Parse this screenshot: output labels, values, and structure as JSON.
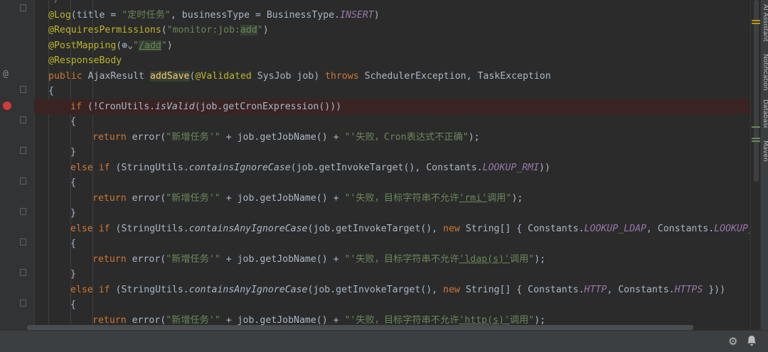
{
  "editor": {
    "lines": [
      {
        "indent": 0,
        "parts": [
          {
            "t": "@Log",
            "c": "c-ann"
          },
          {
            "t": "(title = "
          },
          {
            "t": "\"定时任务\"",
            "c": "c-str"
          },
          {
            "t": ", businessType = BusinessType."
          },
          {
            "t": "INSERT",
            "c": "c-const"
          },
          {
            "t": ")"
          }
        ]
      },
      {
        "indent": 0,
        "parts": [
          {
            "t": "@RequiresPermissions",
            "c": "c-ann"
          },
          {
            "t": "("
          },
          {
            "t": "\"monitor:job:",
            "c": "c-str"
          },
          {
            "t": "add",
            "c": "c-str c-hl"
          },
          {
            "t": "\"",
            "c": "c-str"
          },
          {
            "t": ")"
          }
        ]
      },
      {
        "indent": 0,
        "parts": [
          {
            "t": "@PostMapping",
            "c": "c-ann"
          },
          {
            "t": "(⊕⌄"
          },
          {
            "t": "\"",
            "c": "c-str"
          },
          {
            "t": "/add",
            "c": "c-str c-hl c-under"
          },
          {
            "t": "\"",
            "c": "c-str"
          },
          {
            "t": ")"
          }
        ]
      },
      {
        "indent": 0,
        "parts": [
          {
            "t": "@ResponseBody",
            "c": "c-ann"
          }
        ]
      },
      {
        "indent": 0,
        "parts": [
          {
            "t": "public ",
            "c": "c-kw"
          },
          {
            "t": "AjaxResult "
          },
          {
            "t": "addSave",
            "c": "c-fn c-hl"
          },
          {
            "t": "("
          },
          {
            "t": "@Validated",
            "c": "c-ann"
          },
          {
            "t": " SysJob job) "
          },
          {
            "t": "throws ",
            "c": "c-kw"
          },
          {
            "t": "SchedulerException, TaskException"
          }
        ]
      },
      {
        "indent": 0,
        "parts": [
          {
            "t": "{"
          }
        ]
      },
      {
        "indent": 1,
        "bp": true,
        "parts": [
          {
            "t": "if ",
            "c": "c-kw"
          },
          {
            "t": "(!CronUtils."
          },
          {
            "t": "isValid",
            "c": "c-ital"
          },
          {
            "t": "(job.getCronExpression()))"
          }
        ]
      },
      {
        "indent": 1,
        "parts": [
          {
            "t": "{"
          }
        ]
      },
      {
        "indent": 2,
        "parts": [
          {
            "t": "return ",
            "c": "c-kw"
          },
          {
            "t": "error("
          },
          {
            "t": "\"新增任务'\"",
            "c": "c-str"
          },
          {
            "t": " + job.getJobName() + "
          },
          {
            "t": "\"'失败，Cron表达式不正确\"",
            "c": "c-str"
          },
          {
            "t": ");"
          }
        ]
      },
      {
        "indent": 1,
        "parts": [
          {
            "t": "}"
          }
        ]
      },
      {
        "indent": 1,
        "parts": [
          {
            "t": "else if ",
            "c": "c-kw"
          },
          {
            "t": "(StringUtils."
          },
          {
            "t": "containsIgnoreCase",
            "c": "c-ital"
          },
          {
            "t": "(job.getInvokeTarget(), Constants."
          },
          {
            "t": "LOOKUP_RMI",
            "c": "c-const"
          },
          {
            "t": "))"
          }
        ]
      },
      {
        "indent": 1,
        "parts": [
          {
            "t": "{"
          }
        ]
      },
      {
        "indent": 2,
        "parts": [
          {
            "t": "return ",
            "c": "c-kw"
          },
          {
            "t": "error("
          },
          {
            "t": "\"新增任务'\"",
            "c": "c-str"
          },
          {
            "t": " + job.getJobName() + "
          },
          {
            "t": "\"'失败，目标字符串不允许",
            "c": "c-str"
          },
          {
            "t": "'rmi'",
            "c": "c-str c-under"
          },
          {
            "t": "调用\"",
            "c": "c-str"
          },
          {
            "t": ");"
          }
        ]
      },
      {
        "indent": 1,
        "parts": [
          {
            "t": "}"
          }
        ]
      },
      {
        "indent": 1,
        "parts": [
          {
            "t": "else if ",
            "c": "c-kw"
          },
          {
            "t": "(StringUtils."
          },
          {
            "t": "containsAnyIgnoreCase",
            "c": "c-ital"
          },
          {
            "t": "(job.getInvokeTarget(), "
          },
          {
            "t": "new ",
            "c": "c-kw"
          },
          {
            "t": "String[] { Constants."
          },
          {
            "t": "LOOKUP_LDAP",
            "c": "c-const"
          },
          {
            "t": ", Constants."
          },
          {
            "t": "LOOKUP_LDAP",
            "c": "c-const"
          }
        ]
      },
      {
        "indent": 1,
        "parts": [
          {
            "t": "{"
          }
        ]
      },
      {
        "indent": 2,
        "parts": [
          {
            "t": "return ",
            "c": "c-kw"
          },
          {
            "t": "error("
          },
          {
            "t": "\"新增任务'\"",
            "c": "c-str"
          },
          {
            "t": " + job.getJobName() + "
          },
          {
            "t": "\"'失败，目标字符串不允许",
            "c": "c-str"
          },
          {
            "t": "'ldap(s)'",
            "c": "c-str c-under"
          },
          {
            "t": "调用\"",
            "c": "c-str"
          },
          {
            "t": ");"
          }
        ]
      },
      {
        "indent": 1,
        "parts": [
          {
            "t": "}"
          }
        ]
      },
      {
        "indent": 1,
        "parts": [
          {
            "t": "else if ",
            "c": "c-kw"
          },
          {
            "t": "(StringUtils."
          },
          {
            "t": "containsAnyIgnoreCase",
            "c": "c-ital"
          },
          {
            "t": "(job.getInvokeTarget(), "
          },
          {
            "t": "new ",
            "c": "c-kw"
          },
          {
            "t": "String[] { Constants."
          },
          {
            "t": "HTTP",
            "c": "c-const"
          },
          {
            "t": ", Constants."
          },
          {
            "t": "HTTPS",
            "c": "c-const"
          },
          {
            "t": " }))"
          }
        ]
      },
      {
        "indent": 1,
        "parts": [
          {
            "t": "{"
          }
        ]
      },
      {
        "indent": 2,
        "parts": [
          {
            "t": "return ",
            "c": "c-kw"
          },
          {
            "t": "error("
          },
          {
            "t": "\"新增任务'\"",
            "c": "c-str"
          },
          {
            "t": " + job.getJobName() + "
          },
          {
            "t": "\"'失败，目标字符串不允许",
            "c": "c-str"
          },
          {
            "t": "'http(s)'",
            "c": "c-str c-under"
          },
          {
            "t": "调用\"",
            "c": "c-str"
          },
          {
            "t": ");"
          }
        ]
      }
    ]
  },
  "gutter": {
    "override_marker": "@",
    "breakpoint_line_index": 6,
    "override_line_index": 4
  },
  "tool_windows": {
    "right": [
      "AI Assistant",
      "Notifications",
      "Database",
      "Maven"
    ]
  },
  "status": {
    "settings_icon": "gear-icon",
    "notifications_icon": "bell-icon"
  },
  "colors": {
    "background": "#2b2b2b",
    "keyword": "#cc7832",
    "annotation": "#bbb529",
    "string": "#6a8759",
    "constant": "#9876aa",
    "method_decl": "#ffc66d",
    "breakpoint": "#d33b3b"
  }
}
